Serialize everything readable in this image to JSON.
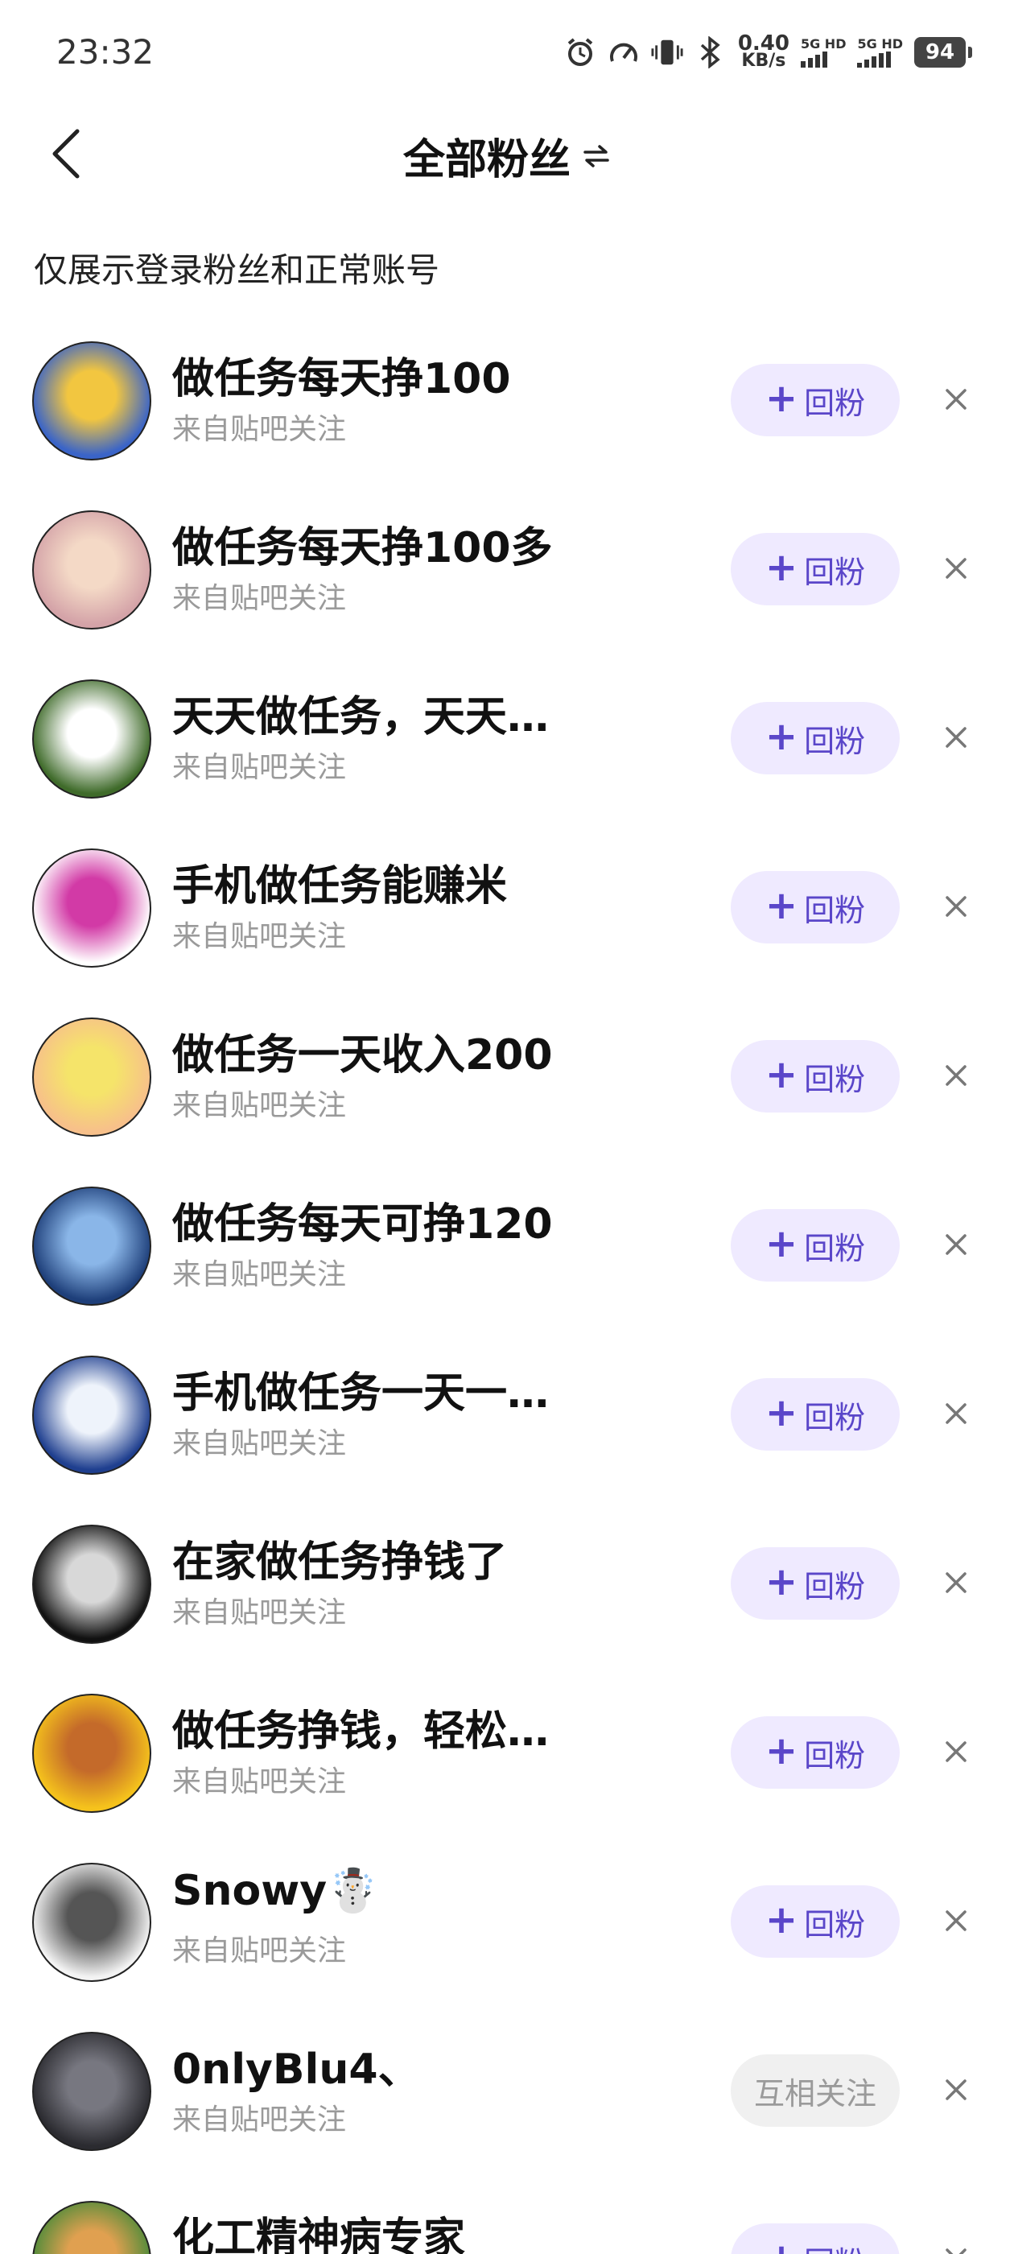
{
  "status_bar": {
    "time": "23:32",
    "speed_value": "0.40",
    "speed_unit": "KB/s",
    "net1": "5G HD",
    "net2": "5G HD",
    "battery": "94"
  },
  "header": {
    "title": "全部粉丝"
  },
  "notice": "仅展示登录粉丝和正常账号",
  "followers": [
    {
      "name": "做任务每天挣100",
      "source": "来自贴吧关注",
      "action": "回粉",
      "avatar_colors": [
        "#3a64c8",
        "#f2c640"
      ]
    },
    {
      "name": "做任务每天挣100多",
      "source": "来自贴吧关注",
      "action": "回粉",
      "avatar_colors": [
        "#d4a3a8",
        "#f4d9c6"
      ]
    },
    {
      "name": "天天做任务，天天…",
      "source": "来自贴吧关注",
      "action": "回粉",
      "avatar_colors": [
        "#3f6b2a",
        "#ffffff"
      ]
    },
    {
      "name": "手机做任务能赚米",
      "source": "来自贴吧关注",
      "action": "回粉",
      "avatar_colors": [
        "#ffffff",
        "#d23aa6"
      ]
    },
    {
      "name": "做任务一天收入200",
      "source": "来自贴吧关注",
      "action": "回粉",
      "avatar_colors": [
        "#f7c08a",
        "#f5e46a"
      ]
    },
    {
      "name": "做任务每天可挣120",
      "source": "来自贴吧关注",
      "action": "回粉",
      "avatar_colors": [
        "#1e3f7a",
        "#8ab6e8"
      ]
    },
    {
      "name": "手机做任务一天一…",
      "source": "来自贴吧关注",
      "action": "回粉",
      "avatar_colors": [
        "#1f3f8f",
        "#eef3fb"
      ]
    },
    {
      "name": "在家做任务挣钱了",
      "source": "来自贴吧关注",
      "action": "回粉",
      "avatar_colors": [
        "#111111",
        "#d8d8d8"
      ]
    },
    {
      "name": "做任务挣钱，轻松…",
      "source": "来自贴吧关注",
      "action": "回粉",
      "avatar_colors": [
        "#f5c21c",
        "#c46a2a"
      ]
    },
    {
      "name": "Snowy☃️",
      "source": "来自贴吧关注",
      "action": "回粉",
      "avatar_colors": [
        "#f3f3f3",
        "#555555"
      ]
    },
    {
      "name": "0nlyBlu4、",
      "source": "来自贴吧关注",
      "action": "互相关注",
      "avatar_colors": [
        "#2b2b30",
        "#777780"
      ]
    },
    {
      "name": "化工精神病专家",
      "source": "",
      "action": "回粉",
      "avatar_colors": [
        "#4e8b3a",
        "#e0a050"
      ]
    }
  ],
  "colors": {
    "accent": "#5a46c9",
    "accent_bg": "#efeaff",
    "muted": "#9a9a9a"
  },
  "icons": [
    "alarm-icon",
    "speed-gauge-icon",
    "vibrate-icon",
    "bluetooth-icon",
    "back-arrow-icon",
    "switch-order-icon",
    "plus-icon",
    "close-icon"
  ]
}
